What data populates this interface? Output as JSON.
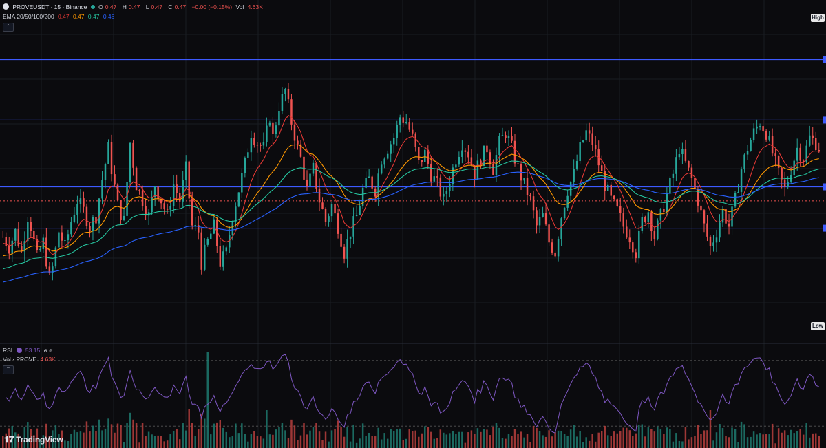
{
  "header": {
    "symbol": "PROVEUSDT · 15 · Binance",
    "open_label": "O",
    "open": "0.47",
    "high_label": "H",
    "high": "0.47",
    "low_label": "L",
    "low": "0.47",
    "close_label": "C",
    "close": "0.47",
    "change": "−0.00 (−0.15%)",
    "vol_label": "Vol",
    "vol": "4.63K"
  },
  "ema_legend": {
    "label": "EMA 20/50/100/200",
    "v20": "0.47",
    "v50": "0.47",
    "v100": "0.47",
    "v200": "0.46"
  },
  "rsi_legend": {
    "label": "RSI",
    "value": "53.15",
    "extra": "ø ø"
  },
  "vol_legend": {
    "label": "Vol · PROVE",
    "value": "4.63K"
  },
  "tags": {
    "high": "High",
    "low": "Low"
  },
  "brand": {
    "name": "TradingView"
  },
  "colors": {
    "up": "#26a69a",
    "down": "#ef5350",
    "ema20": "#e53935",
    "ema50": "#ff9800",
    "ema100": "#26c6a0",
    "ema200": "#2962ff",
    "rsi": "#7e57c2",
    "hline": "#3d5afe"
  },
  "chart_data": {
    "type": "line",
    "price_line": {
      "series": "close",
      "shape_pts": [
        [
          0,
          26
        ],
        [
          2,
          22
        ],
        [
          4,
          28
        ],
        [
          6,
          20
        ],
        [
          8,
          34
        ],
        [
          9,
          30
        ],
        [
          11,
          18
        ],
        [
          13,
          24
        ],
        [
          15,
          10
        ],
        [
          16,
          14
        ],
        [
          18,
          28
        ],
        [
          20,
          22
        ],
        [
          22,
          32
        ],
        [
          24,
          40
        ],
        [
          26,
          36
        ],
        [
          28,
          30
        ],
        [
          30,
          34
        ],
        [
          32,
          48
        ],
        [
          34,
          60
        ],
        [
          35,
          52
        ],
        [
          37,
          38
        ],
        [
          39,
          32
        ],
        [
          41,
          62
        ],
        [
          43,
          46
        ],
        [
          45,
          40
        ],
        [
          47,
          34
        ],
        [
          49,
          46
        ],
        [
          51,
          40
        ],
        [
          53,
          34
        ],
        [
          55,
          46
        ],
        [
          57,
          40
        ],
        [
          59,
          52
        ],
        [
          61,
          30
        ],
        [
          63,
          28
        ],
        [
          64,
          16
        ],
        [
          66,
          24
        ],
        [
          68,
          30
        ],
        [
          70,
          16
        ],
        [
          72,
          20
        ],
        [
          74,
          34
        ],
        [
          76,
          44
        ],
        [
          78,
          54
        ],
        [
          80,
          66
        ],
        [
          82,
          62
        ],
        [
          84,
          60
        ],
        [
          86,
          72
        ],
        [
          87,
          64
        ],
        [
          89,
          76
        ],
        [
          91,
          82
        ],
        [
          93,
          70
        ],
        [
          95,
          60
        ],
        [
          96,
          56
        ],
        [
          98,
          44
        ],
        [
          100,
          52
        ],
        [
          102,
          40
        ],
        [
          104,
          32
        ],
        [
          106,
          38
        ],
        [
          108,
          30
        ],
        [
          110,
          20
        ],
        [
          112,
          28
        ],
        [
          114,
          34
        ],
        [
          116,
          44
        ],
        [
          118,
          48
        ],
        [
          120,
          44
        ],
        [
          122,
          56
        ],
        [
          124,
          60
        ],
        [
          126,
          64
        ],
        [
          128,
          72
        ],
        [
          130,
          70
        ],
        [
          132,
          64
        ],
        [
          134,
          54
        ],
        [
          136,
          58
        ],
        [
          138,
          50
        ],
        [
          140,
          46
        ],
        [
          142,
          40
        ],
        [
          144,
          48
        ],
        [
          146,
          56
        ],
        [
          148,
          62
        ],
        [
          150,
          58
        ],
        [
          152,
          50
        ],
        [
          154,
          56
        ],
        [
          156,
          60
        ],
        [
          158,
          52
        ],
        [
          160,
          62
        ],
        [
          162,
          66
        ],
        [
          164,
          60
        ],
        [
          166,
          52
        ],
        [
          168,
          46
        ],
        [
          170,
          40
        ],
        [
          172,
          30
        ],
        [
          174,
          34
        ],
        [
          176,
          24
        ],
        [
          178,
          20
        ],
        [
          180,
          34
        ],
        [
          182,
          44
        ],
        [
          184,
          50
        ],
        [
          186,
          60
        ],
        [
          188,
          66
        ],
        [
          190,
          62
        ],
        [
          192,
          54
        ],
        [
          194,
          46
        ],
        [
          196,
          40
        ],
        [
          198,
          36
        ],
        [
          200,
          30
        ],
        [
          202,
          26
        ],
        [
          204,
          20
        ],
        [
          206,
          32
        ],
        [
          208,
          36
        ],
        [
          210,
          26
        ],
        [
          212,
          34
        ],
        [
          214,
          42
        ],
        [
          216,
          50
        ],
        [
          218,
          60
        ],
        [
          220,
          54
        ],
        [
          222,
          48
        ],
        [
          224,
          40
        ],
        [
          226,
          30
        ],
        [
          228,
          22
        ],
        [
          230,
          28
        ],
        [
          232,
          36
        ],
        [
          234,
          30
        ],
        [
          236,
          40
        ],
        [
          238,
          52
        ],
        [
          240,
          60
        ],
        [
          242,
          66
        ],
        [
          244,
          70
        ],
        [
          246,
          66
        ],
        [
          248,
          58
        ],
        [
          250,
          50
        ],
        [
          252,
          44
        ],
        [
          254,
          52
        ],
        [
          256,
          60
        ],
        [
          258,
          56
        ],
        [
          260,
          64
        ],
        [
          262,
          62
        ],
        [
          264,
          58
        ]
      ]
    },
    "candles": {
      "count": 264,
      "x_start": 0,
      "x_end": 263
    },
    "ema_overlays": [
      {
        "name": "EMA 20",
        "period": 20
      },
      {
        "name": "EMA 50",
        "period": 50
      },
      {
        "name": "EMA 100",
        "period": 100
      },
      {
        "name": "EMA 200",
        "period": 200
      }
    ],
    "horizontal_levels": [
      0.4865,
      0.477,
      0.4665,
      0.46
    ],
    "dotted_level": 0.4643,
    "price_range": [
      0.442,
      0.495
    ],
    "rsi_levels": [
      70,
      30
    ],
    "rsi_range": [
      20,
      80
    ],
    "grid": true,
    "legend_placement": "top-left"
  }
}
